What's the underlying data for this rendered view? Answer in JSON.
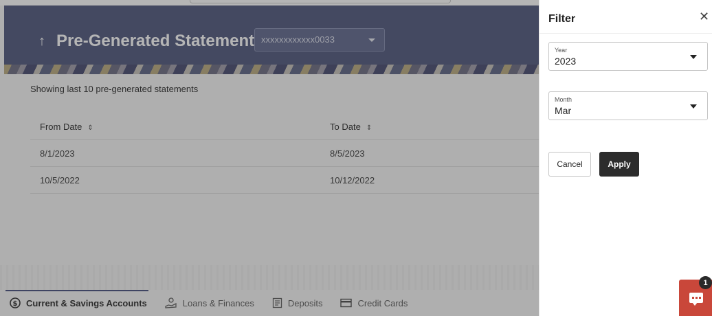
{
  "header": {
    "title": "Pre-Generated Statement",
    "back_icon": "arrow-up-icon",
    "account_selected": "xxxxxxxxxxxx0033"
  },
  "main": {
    "showing_text": "Showing last 10 pre-generated statements",
    "table": {
      "columns": [
        "From Date",
        "To Date"
      ],
      "rows": [
        [
          "8/1/2023",
          "8/5/2023"
        ],
        [
          "10/5/2022",
          "10/12/2022"
        ]
      ]
    }
  },
  "bottom_nav": {
    "items": [
      {
        "label": "Current & Savings Accounts",
        "icon": "dollar-circle-icon",
        "active": true
      },
      {
        "label": "Loans & Finances",
        "icon": "money-hand-icon",
        "active": false
      },
      {
        "label": "Deposits",
        "icon": "document-icon",
        "active": false
      },
      {
        "label": "Credit Cards",
        "icon": "credit-card-icon",
        "active": false
      }
    ]
  },
  "filter": {
    "title": "Filter",
    "year_label": "Year",
    "year_value": "2023",
    "month_label": "Month",
    "month_value": "Mar",
    "cancel_label": "Cancel",
    "apply_label": "Apply"
  },
  "chat": {
    "badge_count": "1"
  },
  "colors": {
    "banner": "#4a5278",
    "apply_button": "#2c2c2c",
    "chat_button": "#c9473a"
  }
}
